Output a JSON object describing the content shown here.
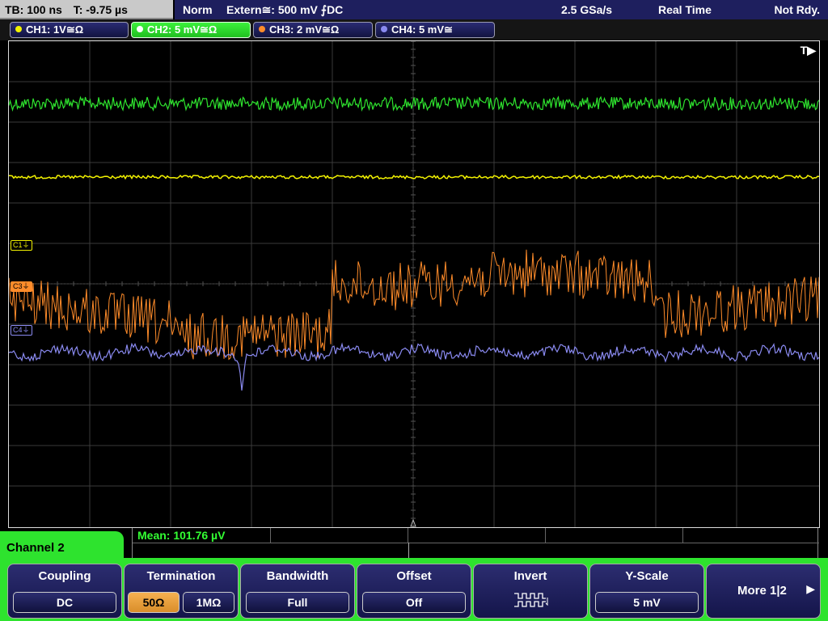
{
  "status": {
    "timebase": "TB: 100 ns",
    "trigger_time": "T: -9.75 µs",
    "mode": "Norm",
    "trigger_source": "Extern≅: 500 mV ⨍DC",
    "sample_rate": "2.5 GSa/s",
    "acq_mode": "Real Time",
    "state": "Not Rdy."
  },
  "channels": [
    {
      "label": "CH1: 1V≅Ω",
      "color": "#f2f200",
      "active": false
    },
    {
      "label": "CH2: 5 mV≅Ω",
      "color": "#2ee32e",
      "active": true
    },
    {
      "label": "CH3: 2 mV≅Ω",
      "color": "#ff8c2a",
      "active": false
    },
    {
      "label": "CH4: 5 mV≅",
      "color": "#8a8af0",
      "active": false
    }
  ],
  "screen": {
    "trigger_marker": "T▶",
    "ch_markers": [
      "C1⏚",
      "C3⏚",
      "C4⏚"
    ]
  },
  "measurement": {
    "text": "Mean: 101.76 µV"
  },
  "menu": {
    "title": "Channel 2",
    "coupling": {
      "label": "Coupling",
      "value": "DC"
    },
    "termination": {
      "label": "Termination",
      "opt1": "50Ω",
      "opt2": "1MΩ"
    },
    "bandwidth": {
      "label": "Bandwidth",
      "value": "Full"
    },
    "offset": {
      "label": "Offset",
      "value": "Off"
    },
    "invert": {
      "label": "Invert"
    },
    "yscale": {
      "label": "Y-Scale",
      "value": "5 mV"
    },
    "more": {
      "label": "More 1|2"
    }
  },
  "colors": {
    "ch1": "#f2f200",
    "ch2": "#2ee32e",
    "ch3": "#ff8c2a",
    "ch4": "#8a8af0",
    "grid": "#3a3a3a",
    "menu_accent": "#2ee32e"
  }
}
